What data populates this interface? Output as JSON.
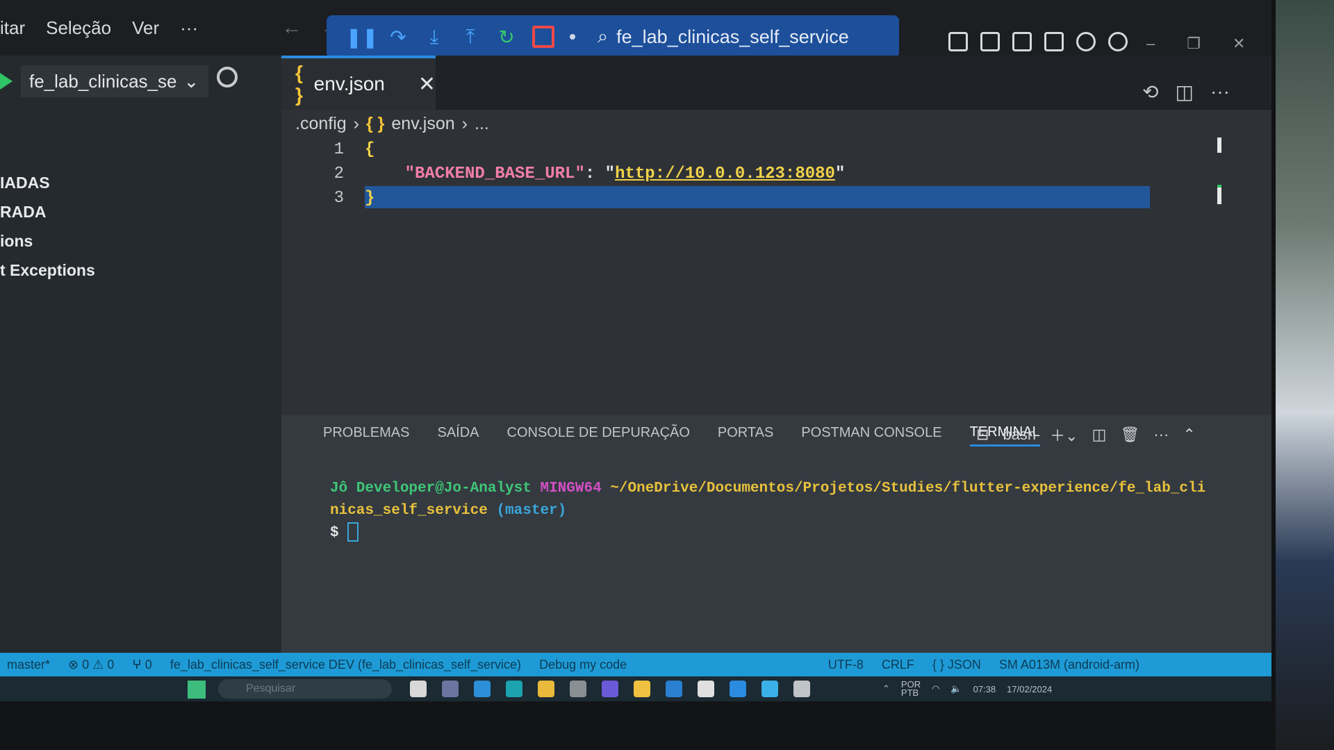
{
  "menu": [
    "itar",
    "Seleção",
    "Ver",
    "···"
  ],
  "nav": {
    "back": "←",
    "forward": "→"
  },
  "debug": {
    "search_icon": "search-icon",
    "search_text": "fe_lab_clinicas_self_service",
    "actions": [
      "pause",
      "step-over",
      "step-into",
      "step-out",
      "restart",
      "stop"
    ]
  },
  "window_controls": [
    "–",
    "❐",
    "✕"
  ],
  "sidebar": {
    "launch_config": "fe_lab_clinicas_se",
    "breakpoint_items": [
      "IADAS",
      "RADA",
      "ions",
      "t Exceptions"
    ]
  },
  "editor": {
    "tab_label": "env.json",
    "tab_icon": "{ }",
    "breadcrumb": [
      ".config",
      "env.json",
      "..."
    ],
    "line_numbers": [
      "1",
      "2",
      "3"
    ],
    "json_key": "\"BACKEND_BASE_URL\"",
    "json_value": "http://10.0.0.123:8080",
    "open_brace": "{",
    "close_brace": "}"
  },
  "panel": {
    "tabs": [
      "PROBLEMAS",
      "SAÍDA",
      "CONSOLE DE DEPURAÇÃO",
      "PORTAS",
      "POSTMAN CONSOLE",
      "TERMINAL"
    ],
    "active_tab": "TERMINAL",
    "shell": "bash",
    "terminal": {
      "user": "Jô Developer@Jo-Analyst",
      "system": "MINGW64",
      "path_line1": "~/OneDrive/Documentos/Projetos/Studies/flutter-experience/fe_lab_cli",
      "path_line2": "nicas_self_service",
      "branch": "(master)",
      "prompt": "$"
    }
  },
  "statusbar": {
    "branch": "master*",
    "errors": "⊗ 0 ⚠ 0",
    "ports": "ⵖ 0",
    "debug_target": "fe_lab_clinicas_self_service DEV (fe_lab_clinicas_self_service)",
    "mode": "Debug my code",
    "encoding": "UTF-8",
    "eol": "CRLF",
    "language": "{ } JSON",
    "device": "SM A013M (android-arm)"
  },
  "taskbar": {
    "search_placeholder": "Pesquisar",
    "lang": "POR\nPTB",
    "time": "07:38",
    "date": "17/02/2024"
  },
  "colors": {
    "accent": "#1e9bd6",
    "debug_bar": "#1d4f9a",
    "json_key": "#f07fa8",
    "json_string": "#f0d24a"
  }
}
